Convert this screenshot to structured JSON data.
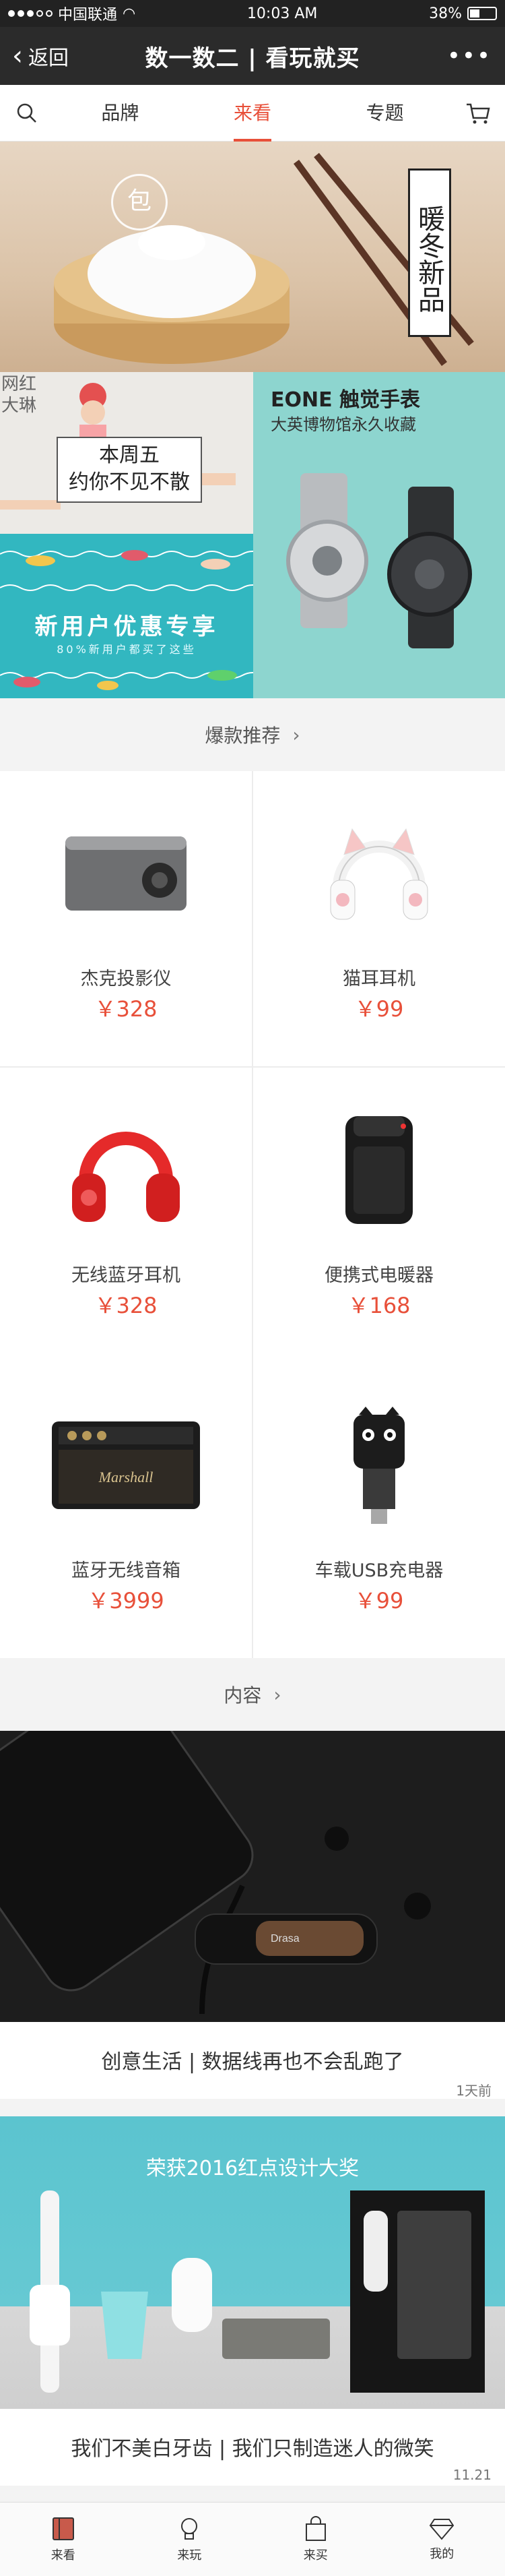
{
  "status_bar": {
    "carrier": "中国联通",
    "time": "10:03 AM",
    "battery": "38%"
  },
  "nav": {
    "back_label": "返回",
    "title": "数一数二 | 看玩就买",
    "more_icon": "more-dots-icon"
  },
  "tabs": {
    "search_icon": "search-icon",
    "items": [
      "品牌",
      "来看",
      "专题"
    ],
    "active": "来看",
    "cart_icon": "cart-icon"
  },
  "hero": {
    "vertical_text": "暖冬新品",
    "logo_glyph": "包"
  },
  "promos": {
    "top_left": {
      "side_label": "网红\n大琳",
      "card_line1": "本周五",
      "card_line2": "约你不见不散"
    },
    "bottom_left": {
      "headline": "新用户优惠专享",
      "subline": "80%新用户都买了这些"
    },
    "right": {
      "title": "EONE 触觉手表",
      "subtitle": "大英博物馆永久收藏"
    }
  },
  "hot_section": {
    "label": "爆款推荐"
  },
  "products": [
    {
      "name": "杰克投影仪",
      "price": "￥328",
      "icon": "projector-icon"
    },
    {
      "name": "猫耳耳机",
      "price": "￥99",
      "icon": "cat-ear-headphones-icon"
    },
    {
      "name": "无线蓝牙耳机",
      "price": "￥328",
      "icon": "red-headphones-icon"
    },
    {
      "name": "便携式电暖器",
      "price": "￥168",
      "icon": "heater-icon"
    },
    {
      "name": "蓝牙无线音箱",
      "price": "￥3999",
      "icon": "speaker-icon"
    },
    {
      "name": "车载USB充电器",
      "price": "￥99",
      "icon": "car-charger-icon"
    }
  ],
  "content_section": {
    "label": "内容"
  },
  "articles": [
    {
      "title": "创意生活 | 数据线再也不会乱跑了",
      "time": "1天前",
      "image_text": "Drasa"
    },
    {
      "title": "我们不美白牙齿 | 我们只制造迷人的微笑",
      "time": "11.21",
      "image_text": "荣获2016红点设计大奖"
    }
  ],
  "bottom_tabs": [
    {
      "label": "来看",
      "icon": "book-icon"
    },
    {
      "label": "来玩",
      "icon": "lightbulb-icon"
    },
    {
      "label": "来买",
      "icon": "bag-icon"
    },
    {
      "label": "我的",
      "icon": "diamond-icon"
    }
  ],
  "colors": {
    "accent": "#e8503a",
    "nav_bg": "#2b2b2b",
    "teal": "#32b7c0"
  }
}
